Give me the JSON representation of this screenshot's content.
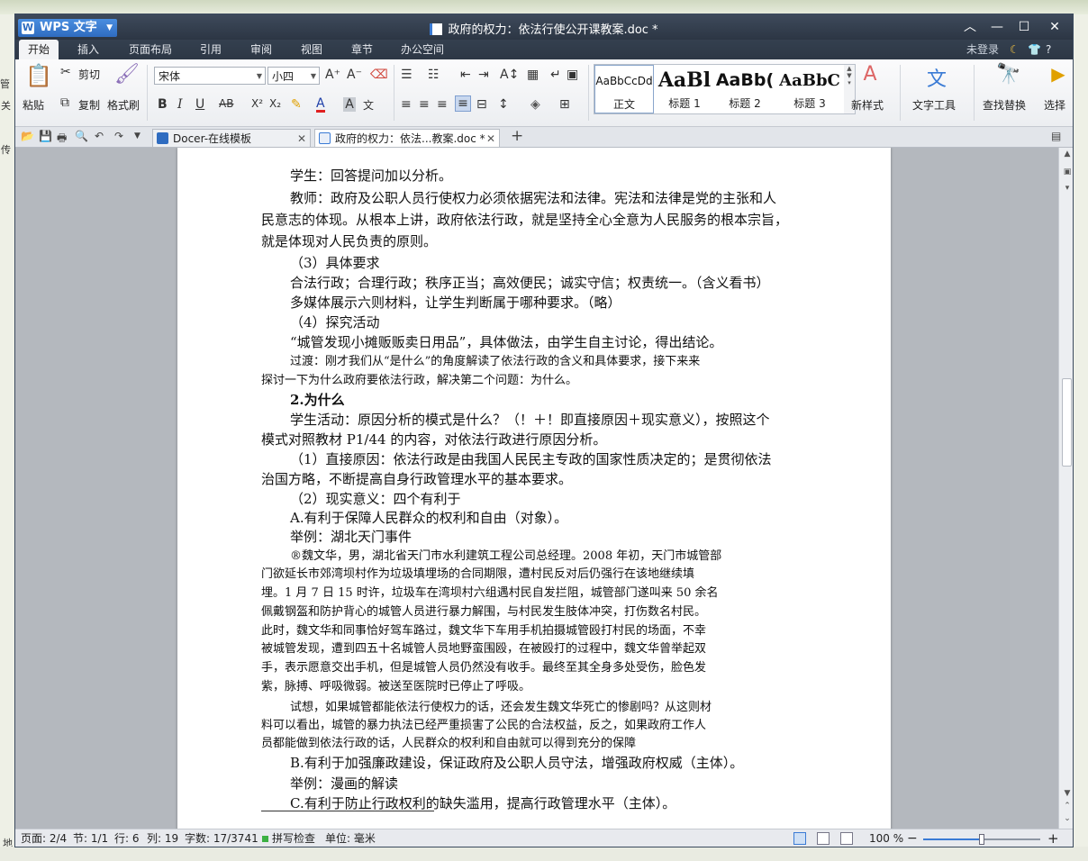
{
  "window": {
    "app_name": "WPS 文字",
    "title": "政府的权力：依法行使公开课教案.doc *",
    "controls": [
      "︿",
      "—",
      "☐",
      "✕"
    ]
  },
  "menu": {
    "tabs": [
      "开始",
      "插入",
      "页面布局",
      "引用",
      "审阅",
      "视图",
      "章节",
      "办公空间"
    ],
    "login": "未登录",
    "help": "?"
  },
  "ribbon": {
    "paste": "粘贴",
    "cut": "剪切",
    "copy": "复制",
    "format_painter": "格式刷",
    "font_name": "宋体",
    "font_size": "小四",
    "styles": [
      {
        "sample": "AaBbCcDd",
        "name": "正文"
      },
      {
        "sample": "AaBl",
        "name": "标题 1"
      },
      {
        "sample": "AaBb(",
        "name": "标题 2"
      },
      {
        "sample": "AaBbC",
        "name": "标题 3"
      }
    ],
    "new_style": "新样式",
    "text_tools": "文字工具",
    "find_replace": "查找替换",
    "select": "选择"
  },
  "tabs": {
    "docer": "Docer-在线模板",
    "document": "政府的权力：依法...教案.doc *",
    "new_tab": "+"
  },
  "document": {
    "lines": [
      {
        "text": "学生：回答提问加以分析。",
        "indent": 1
      },
      {
        "text": "教师：政府及公职人员行使权力必须依据宪法和法律。宪法和法律是党的主张和人",
        "indent": 1
      },
      {
        "text": "民意志的体现。从根本上讲，政府依法行政，就是坚持全心全意为人民服务的根本宗旨，",
        "indent": 0
      },
      {
        "text": "就是体现对人民负责的原则。",
        "indent": 0
      },
      {
        "text": "（3）具体要求",
        "indent": 1
      },
      {
        "text": "合法行政；合理行政；秩序正当；高效便民；诚实守信；权责统一。（含义看书）",
        "indent": 1
      },
      {
        "text": "多媒体展示六则材料，让学生判断属于哪种要求。（略）",
        "indent": 1
      },
      {
        "text": "（4）探究活动",
        "indent": 1
      },
      {
        "text": "“城管发现小摊贩贩卖日用品”，具体做法，由学生自主讨论，得出结论。",
        "indent": 1
      },
      {
        "text": "过渡：刚才我们从“是什么”的角度解读了依法行政的含义和具体要求，接下来来",
        "indent": 1,
        "style": "kai"
      },
      {
        "text": "探讨一下为什么政府要依法行政，解决第二个问题：为什么。",
        "indent": 0,
        "style": "kai"
      },
      {
        "text": "2.为什么",
        "indent": 1,
        "style": "bold"
      },
      {
        "text": "学生活动：原因分析的模式是什么？（！＋！即直接原因＋现实意义），按照这个",
        "indent": 1
      },
      {
        "text": "模式对照教材 P1/44 的内容，对依法行政进行原因分析。",
        "indent": 0
      },
      {
        "text": "（1）直接原因：依法行政是由我国人民民主专政的国家性质决定的；是贯彻依法",
        "indent": 1
      },
      {
        "text": "治国方略，不断提高自身行政管理水平的基本要求。",
        "indent": 0
      },
      {
        "text": "（2）现实意义：四个有利于",
        "indent": 1
      },
      {
        "text": "A.有利于保障人民群众的权利和自由（对象）。",
        "indent": 1
      },
      {
        "text": "举例：湖北天门事件",
        "indent": 1
      },
      {
        "text": "®魏文华，男，湖北省天门市水利建筑工程公司总经理。2008 年初，天门市城管部",
        "indent": 1,
        "style": "kai"
      },
      {
        "text": "门欲延长市郊湾坝村作为垃圾填埋场的合同期限，遭村民反对后仍强行在该地继续填",
        "indent": 0,
        "style": "kai"
      },
      {
        "text": "埋。1 月 7 日 15 时许，垃圾车在湾坝村六组遇村民自发拦阻，城管部门遂叫来 50 余名",
        "indent": 0,
        "style": "kai"
      },
      {
        "text": "佩戴钢盔和防护背心的城管人员进行暴力解围，与村民发生肢体冲突，打伤数名村民。",
        "indent": 0,
        "style": "kai"
      },
      {
        "text": "此时，魏文华和同事恰好驾车路过，魏文华下车用手机拍摄城管殴打村民的场面，不幸",
        "indent": 0,
        "style": "kai"
      },
      {
        "text": "被城管发现，遭到四五十名城管人员地野蛮围殴，在被殴打的过程中，魏文华曾举起双",
        "indent": 0,
        "style": "kai"
      },
      {
        "text": "手，表示愿意交出手机，但是城管人员仍然没有收手。最终至其全身多处受伤，脸色发",
        "indent": 0,
        "style": "kai"
      },
      {
        "text": "紫，脉搏、呼吸微弱。被送至医院时已停止了呼吸。",
        "indent": 0,
        "style": "kai"
      },
      {
        "text": "试想，如果城管都能依法行使权力的话，还会发生魏文华死亡的惨剧吗？从这则材",
        "indent": 1,
        "style": "kai"
      },
      {
        "text": "料可以看出，城管的暴力执法已经严重损害了公民的合法权益，反之，如果政府工作人",
        "indent": 0,
        "style": "kai"
      },
      {
        "text": "员都能做到依法行政的话，人民群众的权利和自由就可以得到充分的保障",
        "indent": 0,
        "style": "kai"
      },
      {
        "text": "B.有利于加强廉政建设，保证政府及公职人员守法，增强政府权威（主体）。",
        "indent": 1
      },
      {
        "text": "举例：漫画的解读",
        "indent": 1
      },
      {
        "text": "C.有利于防止行政权利的缺失滥用，提高行政管理水平（主体）。",
        "indent": 1
      }
    ]
  },
  "status": {
    "page": "页面: 2/4",
    "section": "节: 1/1",
    "row": "行: 6",
    "col": "列: 19",
    "word_count": "字数: 17/3741",
    "spell_check": "拼写检查",
    "unit": "单位: 毫米",
    "zoom": "100 %",
    "zoom_level": 0.5,
    "zoom_minus": "−",
    "zoom_plus": "+"
  },
  "desktop": {
    "fragments": [
      "管",
      "关",
      "传",
      "地"
    ]
  },
  "colors": {
    "accent": "#3a7bd5",
    "titlebar": "#34404f",
    "spell_ok": "#3cb043"
  }
}
